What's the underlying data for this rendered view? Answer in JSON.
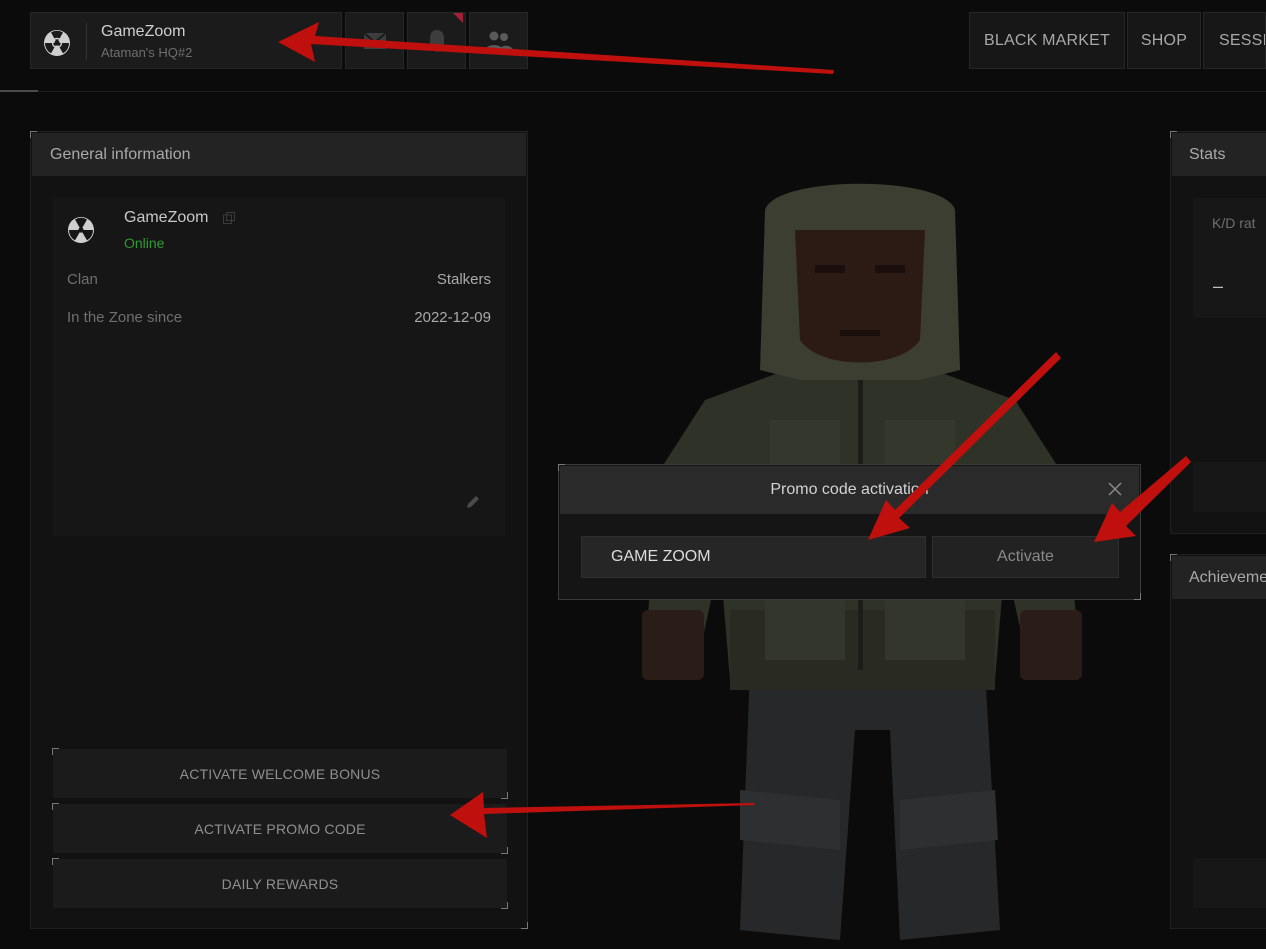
{
  "profile": {
    "name": "GameZoom",
    "location": "Ataman's HQ#2"
  },
  "top_icons": [
    "mail-icon",
    "bell-icon",
    "friends-icon"
  ],
  "nav": [
    {
      "label": "BLACK MARKET"
    },
    {
      "label": "SHOP"
    },
    {
      "label": "SESSIO"
    }
  ],
  "general_info": {
    "title": "General information",
    "username": "GameZoom",
    "status": "Online",
    "clan_label": "Clan",
    "clan_value": "Stalkers",
    "since_label": "In the Zone since",
    "since_value": "2022-12-09"
  },
  "actions": {
    "welcome_bonus": "ACTIVATE WELCOME BONUS",
    "promo_code": "ACTIVATE PROMO CODE",
    "daily_rewards": "DAILY REWARDS"
  },
  "stats": {
    "title": "Stats",
    "kd_label": "K/D rat",
    "kd_value": "–"
  },
  "achievements": {
    "title": "Achieveme"
  },
  "modal": {
    "title": "Promo code activation",
    "input_value": "GAME ZOOM",
    "activate_label": "Activate"
  },
  "colors": {
    "online": "#2e9a36",
    "annotation_arrow": "#c0100e",
    "notification": "#a0203a"
  }
}
